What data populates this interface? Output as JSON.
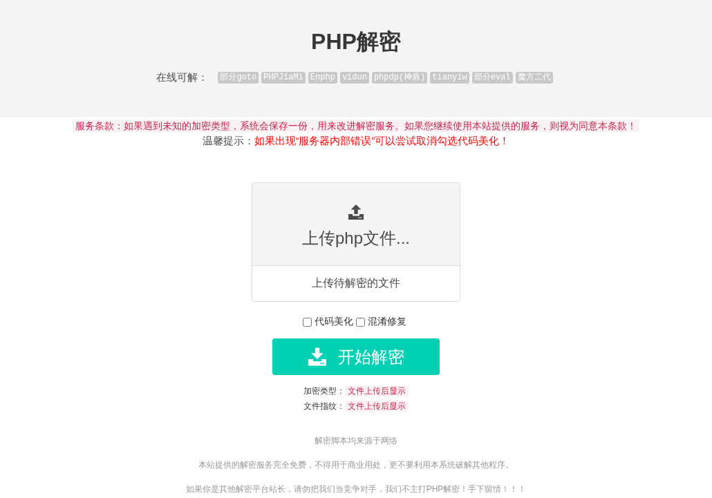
{
  "header": {
    "title": "PHP解密",
    "supported_label": "在线可解：",
    "supported": [
      "部分goto",
      "PHPJiaMi",
      "Enphp",
      "vidun",
      "phpdp(神盾)",
      "tianyiw",
      "部分eval",
      "魔方二代"
    ]
  },
  "notices": {
    "terms": "服务条款：如果遇到未知的加密类型，系统会保存一份，用来改进解密服务。如果您继续使用本站提供的服务，则视为同意本条款！",
    "tip_label": "温馨提示：",
    "tip": "如果出现“服务器内部错误”可以尝试取消勾选代码美化！"
  },
  "upload": {
    "title": "上传php文件...",
    "caption": "上传待解密的文件"
  },
  "options": [
    {
      "label": "代码美化",
      "checked": false
    },
    {
      "label": "混淆修复",
      "checked": false
    }
  ],
  "decrypt_button": "开始解密",
  "info": [
    {
      "label": "加密类型：",
      "value": "文件上传后显示"
    },
    {
      "label": "文件指纹：",
      "value": "文件上传后显示"
    }
  ],
  "footer": [
    "解密脚本均来源于网络",
    "本站提供的解密服务完全免费，不得用于商业用处，更不要利用本系统破解其他程序。",
    "如果你是其他解密平台站长，请勿把我们当竞争对手，我们不主打PHP解密！手下留情！！！"
  ]
}
